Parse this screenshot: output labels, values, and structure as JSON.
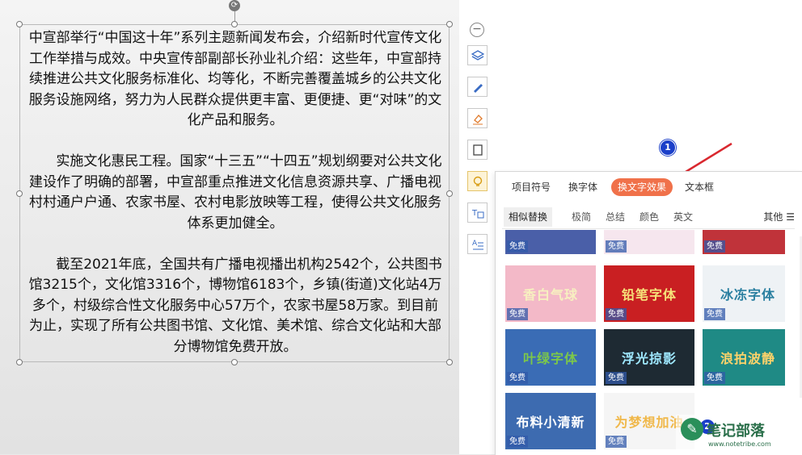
{
  "document": {
    "paragraphs": [
      "中宣部举行“中国这十年”系列主题新闻发布会，介绍新时代宣传文化工作举措与成效。中央宣传部副部长孙业礼介绍：这些年，中宣部持续推进公共文化服务标准化、均等化，不断完善覆盖城乡的公共文化服务设施网络，努力为人民群众提供更丰富、更便捷、更“对味”的文化产品和服务。",
      "实施文化惠民工程。国家“十三五”“十四五”规划纲要对公共文化建设作了明确的部署，中宣部重点推进文化信息资源共享、广播电视村村通户户通、农家书屋、农村电影放映等工程，使得公共文化服务体系更加健全。",
      "截至2021年底，全国共有广播电视播出机构2542个，公共图书馆3215个，文化馆3316个，博物馆6183个，乡镇(街道)文化站4万多个，村级综合性文化服务中心57万个，农家书屋58万家。到目前为止，实现了所有公共图书馆、文化馆、美术馆、综合文化站和大部分博物馆免费开放。"
    ]
  },
  "toolbar": {
    "icons": [
      "minus-icon",
      "layers-icon",
      "pen-icon",
      "eraser-icon",
      "frame-icon",
      "bulb-icon",
      "text-switch-icon",
      "text-align-icon"
    ]
  },
  "panel": {
    "tabs": [
      "项目符号",
      "换字体",
      "换文字效果",
      "文本框"
    ],
    "active_tab": "换文字效果",
    "subtabs": [
      "相似替换",
      "极简",
      "总结",
      "颜色",
      "英文"
    ],
    "active_subtab": "相似替换",
    "other_label": "其他 ☰",
    "badge": "免费",
    "tiles": [
      {
        "text": "",
        "bg": "#4a5fa8"
      },
      {
        "text": "",
        "bg": "#f6e6ee"
      },
      {
        "text": "",
        "bg": "#c0333a"
      },
      {
        "text": "香白气球",
        "bg": "#f3b9c8"
      },
      {
        "text": "铅笔字体",
        "bg": "#c91f22"
      },
      {
        "text": "冰冻字体",
        "bg": "#eef2f5"
      },
      {
        "text": "叶绿字体",
        "bg": "#3a6cb5"
      },
      {
        "text": "浮光掠影",
        "bg": "#1e2a33"
      },
      {
        "text": "浪拍波静",
        "bg": "#1f8a85"
      },
      {
        "text": "布料小清新",
        "bg": "#3d6bb0"
      },
      {
        "text": "为梦想加油",
        "bg": "#f5f5f5"
      }
    ]
  },
  "annotations": {
    "marker1": "1",
    "marker2": "2"
  },
  "watermark": {
    "title": "笔记部落",
    "url": "www.notetribe.com"
  },
  "colors": {
    "accent": "#f0714a",
    "arrow": "#d9282f",
    "marker": "#1b3fc9"
  }
}
